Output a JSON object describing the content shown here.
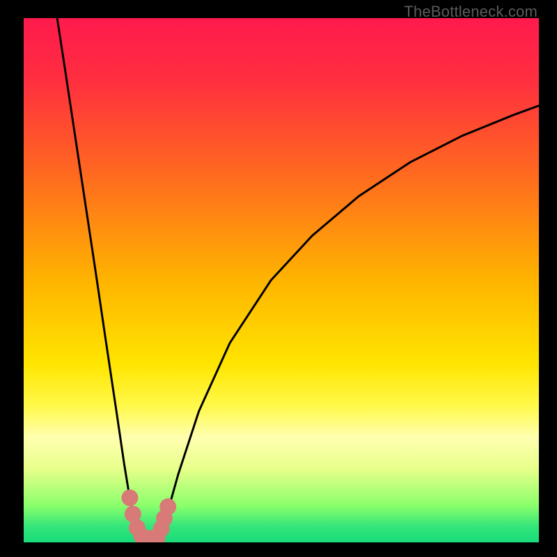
{
  "watermark": "TheBottleneck.com",
  "chart_data": {
    "type": "line",
    "title": "",
    "xlabel": "",
    "ylabel": "",
    "xlim": [
      0,
      100
    ],
    "ylim": [
      0,
      100
    ],
    "gradient_stops": [
      {
        "pos": 0.0,
        "color": "#ff1a4d"
      },
      {
        "pos": 0.12,
        "color": "#ff2f3f"
      },
      {
        "pos": 0.3,
        "color": "#ff6a1f"
      },
      {
        "pos": 0.5,
        "color": "#ffb400"
      },
      {
        "pos": 0.66,
        "color": "#ffe500"
      },
      {
        "pos": 0.74,
        "color": "#fff94a"
      },
      {
        "pos": 0.8,
        "color": "#ffffb0"
      },
      {
        "pos": 0.86,
        "color": "#e7ff8a"
      },
      {
        "pos": 0.93,
        "color": "#8aff6b"
      },
      {
        "pos": 0.97,
        "color": "#33e57a"
      },
      {
        "pos": 1.0,
        "color": "#18dc7a"
      }
    ],
    "series": [
      {
        "name": "left-branch",
        "x": [
          6.5,
          8,
          10,
          12,
          14,
          16,
          18,
          19.5,
          20.5,
          21.3,
          22.0,
          22.6,
          23.0
        ],
        "y": [
          100,
          90.4,
          77.4,
          64.4,
          51.4,
          38.1,
          25.0,
          15.0,
          9.0,
          5.0,
          3.0,
          1.5,
          0.5
        ]
      },
      {
        "name": "right-branch",
        "x": [
          26.0,
          26.8,
          28.0,
          30.0,
          34.0,
          40.0,
          48.0,
          56.0,
          65.0,
          75.0,
          85.0,
          95.0,
          100.0
        ],
        "y": [
          0.5,
          2.0,
          6.0,
          13.0,
          25.0,
          38.0,
          50.0,
          58.5,
          66.0,
          72.5,
          77.5,
          81.5,
          83.3
        ]
      }
    ],
    "markers": {
      "name": "highlight-points",
      "color": "#d87a78",
      "points": [
        {
          "x": 20.6,
          "y": 8.5
        },
        {
          "x": 21.2,
          "y": 5.4
        },
        {
          "x": 22.0,
          "y": 2.8
        },
        {
          "x": 22.9,
          "y": 1.2
        },
        {
          "x": 24.0,
          "y": 0.7
        },
        {
          "x": 25.0,
          "y": 0.8
        },
        {
          "x": 25.9,
          "y": 0.8
        },
        {
          "x": 26.7,
          "y": 2.6
        },
        {
          "x": 27.3,
          "y": 4.6
        },
        {
          "x": 28.0,
          "y": 6.8
        }
      ]
    }
  }
}
